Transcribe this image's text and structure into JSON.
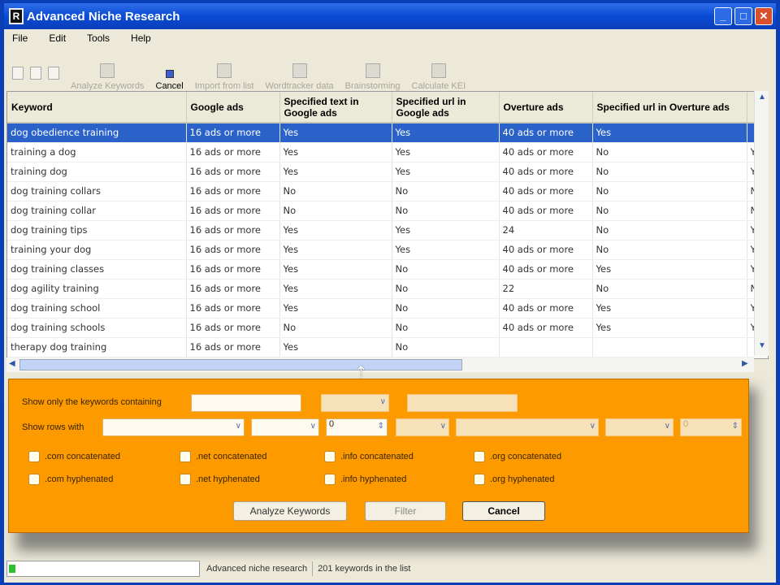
{
  "window": {
    "title": "Advanced Niche Research",
    "app_icon": "R"
  },
  "menu": [
    "File",
    "Edit",
    "Tools",
    "Help"
  ],
  "toolbar": [
    "Analyze Keywords",
    "Cancel",
    "Import from list",
    "Wordtracker data",
    "Brainstorming",
    "Calculate KEI"
  ],
  "table": {
    "columns": [
      "Keyword",
      "Google ads",
      "Specified text in Google ads",
      "Specified url in Google ads",
      "Overture ads",
      "Specified url in Overture ads",
      ""
    ],
    "rows": [
      [
        "dog obedience training",
        "16 ads or more",
        "Yes",
        "Yes",
        "40 ads or more",
        "Yes",
        ""
      ],
      [
        "training a dog",
        "16 ads or more",
        "Yes",
        "Yes",
        "40 ads or more",
        "No",
        "Y"
      ],
      [
        "training dog",
        "16 ads or more",
        "Yes",
        "Yes",
        "40 ads or more",
        "No",
        "Y"
      ],
      [
        "dog training collars",
        "16 ads or more",
        "No",
        "No",
        "40 ads or more",
        "No",
        "N"
      ],
      [
        "dog training collar",
        "16 ads or more",
        "No",
        "No",
        "40 ads or more",
        "No",
        "N"
      ],
      [
        "dog training tips",
        "16 ads or more",
        "Yes",
        "Yes",
        "24",
        "No",
        "Y"
      ],
      [
        "training your dog",
        "16 ads or more",
        "Yes",
        "Yes",
        "40 ads or more",
        "No",
        "Y"
      ],
      [
        "dog training classes",
        "16 ads or more",
        "Yes",
        "No",
        "40 ads or more",
        "Yes",
        "Y"
      ],
      [
        "dog agility training",
        "16 ads or more",
        "Yes",
        "No",
        "22",
        "No",
        "N"
      ],
      [
        "dog training school",
        "16 ads or more",
        "Yes",
        "No",
        "40 ads or more",
        "Yes",
        "Y"
      ],
      [
        "dog training schools",
        "16 ads or more",
        "No",
        "No",
        "40 ads or more",
        "Yes",
        "Y"
      ],
      [
        "therapy dog training",
        "16 ads or more",
        "Yes",
        "No",
        "",
        "",
        ""
      ]
    ]
  },
  "filter": {
    "contains_label": "Show only the keywords containing",
    "rows_label": "Show rows with",
    "number_value": "0",
    "disabled_number": "0",
    "checkboxes": [
      ".com concatenated",
      ".net concatenated",
      ".info concatenated",
      ".org concatenated",
      ".com hyphenated",
      ".net hyphenated",
      ".info hyphenated",
      ".org hyphenated"
    ],
    "buttons": {
      "analyze": "Analyze Keywords",
      "filter": "Filter",
      "cancel": "Cancel"
    }
  },
  "status": {
    "app": "Advanced niche research",
    "count": "201 keywords in the list"
  }
}
